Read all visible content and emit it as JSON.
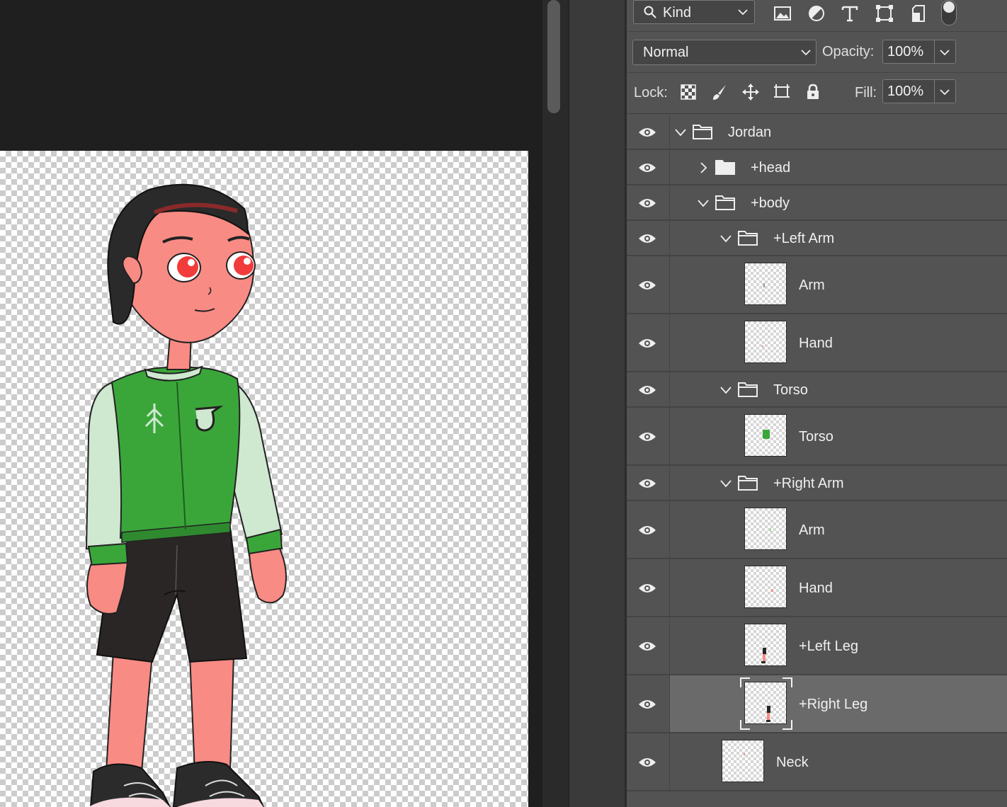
{
  "filter": {
    "kind_label": "Kind",
    "icons": [
      "image-filter-icon",
      "adjustment-filter-icon",
      "type-filter-icon",
      "shape-filter-icon",
      "smart-object-filter-icon"
    ]
  },
  "blend": {
    "mode": "Normal",
    "opacity_label": "Opacity:",
    "opacity_value": "100%"
  },
  "lock": {
    "label": "Lock:",
    "fill_label": "Fill:",
    "fill_value": "100%"
  },
  "layers": [
    {
      "name": "Jordan",
      "type": "group",
      "depth": 0,
      "expanded": true
    },
    {
      "name": "+head",
      "type": "group",
      "depth": 1,
      "expanded": false
    },
    {
      "name": "+body",
      "type": "group",
      "depth": 1,
      "expanded": true
    },
    {
      "name": "+Left Arm",
      "type": "group",
      "depth": 2,
      "expanded": true
    },
    {
      "name": "Arm",
      "type": "layer",
      "depth": 3
    },
    {
      "name": "Hand",
      "type": "layer",
      "depth": 3
    },
    {
      "name": "Torso",
      "type": "group",
      "depth": 2,
      "expanded": true
    },
    {
      "name": "Torso",
      "type": "layer",
      "depth": 3
    },
    {
      "name": "+Right Arm",
      "type": "group",
      "depth": 2,
      "expanded": true
    },
    {
      "name": "Arm",
      "type": "layer",
      "depth": 3
    },
    {
      "name": "Hand",
      "type": "layer",
      "depth": 3
    },
    {
      "name": "+Left Leg",
      "type": "layer",
      "depth": 3
    },
    {
      "name": "+Right Leg",
      "type": "layer",
      "depth": 3,
      "selected": true
    },
    {
      "name": "Neck",
      "type": "layer",
      "depth": 2
    }
  ],
  "colors": {
    "panel_bg": "#535353",
    "selected_row": "#6a6a6a",
    "jacket_green": "#3aa63a",
    "skin": "#f88b84"
  }
}
